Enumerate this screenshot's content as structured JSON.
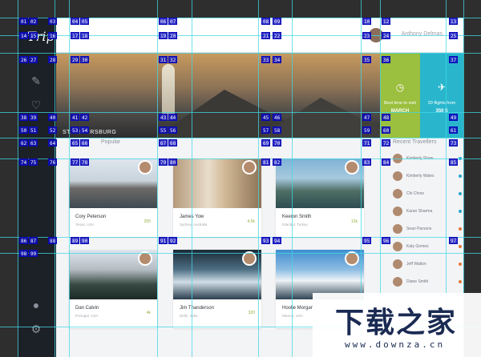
{
  "app": {
    "brand": "Trip"
  },
  "topbar": {
    "user_name": "Anthony Delmas"
  },
  "sidebar": {
    "icons": [
      "feather-icon",
      "heart-icon",
      "bell-icon",
      "settings-icon"
    ]
  },
  "hero": {
    "city": "ST. PETERSBURG"
  },
  "panels": {
    "best_time": {
      "label": "Best time to visit",
      "value": "MARCH"
    },
    "flights": {
      "label": "20 flights from",
      "value": "350 $"
    }
  },
  "sections": {
    "popular": "Popular",
    "recent": "Recent Travellers"
  },
  "cards": [
    {
      "name": "Cory Peterson",
      "location": "Texas, USA",
      "likes": "255"
    },
    {
      "name": "James Yow",
      "location": "Sydney, Australia",
      "likes": "4.5k"
    },
    {
      "name": "Keeron Smith",
      "location": "Istanbul, Turkey",
      "likes": "12k"
    },
    {
      "name": "Dan Calvin",
      "location": "Portugal, USA",
      "likes": "4k"
    },
    {
      "name": "Jim Thanderson",
      "location": "Delhi, India",
      "likes": "320"
    },
    {
      "name": "Hoolie Morgan",
      "location": "Mexico, USA",
      "likes": ""
    }
  ],
  "travellers": [
    {
      "name": "Kimberly Shaw",
      "status_color": "#2aa7c9"
    },
    {
      "name": "Kimberly Wales",
      "status_color": "#2aa7c9"
    },
    {
      "name": "Chi Chow",
      "status_color": "#2aa7c9"
    },
    {
      "name": "Karan Sharma",
      "status_color": "#2aa7c9"
    },
    {
      "name": "Sean Parsons",
      "status_color": "#e07a3b"
    },
    {
      "name": "Katy Gomes",
      "status_color": "#e07a3b"
    },
    {
      "name": "Jeff Walton",
      "status_color": "#e07a3b"
    },
    {
      "name": "Diane Smith",
      "status_color": "#e07a3b"
    }
  ],
  "guide_tags": [
    "01",
    "02",
    "03",
    "04",
    "05",
    "06",
    "07",
    "08",
    "09",
    "10",
    "12",
    "13",
    "14",
    "15",
    "16",
    "17",
    "18",
    "19",
    "20",
    "21",
    "22",
    "23",
    "24",
    "25",
    "26",
    "27",
    "28",
    "29",
    "30",
    "31",
    "32",
    "33",
    "34",
    "35",
    "36",
    "37",
    "38",
    "39",
    "40",
    "41",
    "42",
    "43",
    "44",
    "45",
    "46",
    "47",
    "48",
    "49",
    "50",
    "51",
    "52",
    "53",
    "54",
    "55",
    "56",
    "57",
    "58",
    "59",
    "60",
    "61",
    "62",
    "63",
    "64",
    "65",
    "66",
    "67",
    "68",
    "69",
    "70",
    "71",
    "72",
    "73",
    "74",
    "75",
    "76",
    "77",
    "78",
    "79",
    "80",
    "81",
    "82",
    "83",
    "84",
    "85",
    "86",
    "87",
    "88",
    "89",
    "90",
    "91",
    "92",
    "93",
    "94",
    "95",
    "96",
    "97",
    "98",
    "99"
  ],
  "watermark": {
    "logo": "下载之家",
    "url": "www.downza.cn"
  },
  "colors": {
    "lime": "#9bbf3e",
    "cyan": "#29b6cc",
    "guide": "#40d8e6",
    "tag": "#0e0ebe"
  }
}
